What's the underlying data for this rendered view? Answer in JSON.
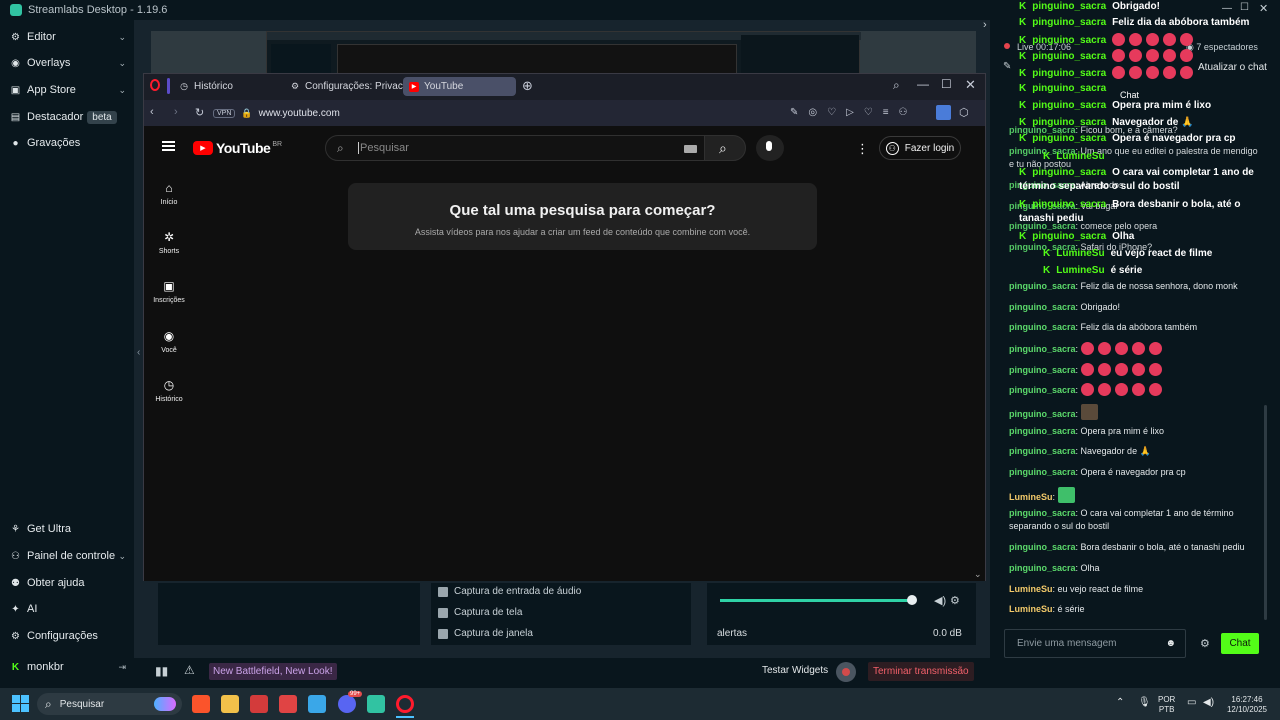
{
  "streamlabs": {
    "title": "Streamlabs Desktop - 1.19.6",
    "sidebar": [
      {
        "label": "Editor",
        "icon": "edit-icon",
        "chevron": true
      },
      {
        "label": "Overlays",
        "icon": "palette-icon",
        "chevron": true
      },
      {
        "label": "App Store",
        "icon": "store-icon",
        "chevron": true
      },
      {
        "label": "Destacador",
        "icon": "highlight-icon",
        "badge": "beta"
      },
      {
        "label": "Gravações",
        "icon": "recording-icon"
      }
    ],
    "sidebar_bottom": [
      {
        "label": "Get Ultra",
        "icon": "ultra-icon"
      },
      {
        "label": "Painel de controle",
        "icon": "dashboard-icon",
        "chevron": true
      },
      {
        "label": "Obter ajuda",
        "icon": "help-icon"
      },
      {
        "label": "AI",
        "icon": "ai-icon"
      },
      {
        "label": "Configurações",
        "icon": "settings-icon"
      },
      {
        "label": "monkbr",
        "icon": "kick-icon"
      }
    ],
    "sources": [
      "Captura de entrada de áudio",
      "Captura de tela",
      "Captura de janela"
    ],
    "mixer": {
      "label": "alertas",
      "level": "0.0 dB",
      "volume_fraction": 0.98
    },
    "footer": {
      "promo": "New Battlefield, New Look!",
      "test_widgets": "Testar Widgets",
      "end_stream": "Terminar transmissão"
    },
    "live": {
      "status": "Live 00:17:06",
      "viewers": "7 espectadores",
      "refresh": "Atualizar o chat",
      "chat_title": "Chat"
    }
  },
  "browser": {
    "tabs": [
      {
        "label": "Histórico",
        "icon": "history-icon"
      },
      {
        "label": "Configurações: Privacidad",
        "icon": "gear-icon"
      },
      {
        "label": "YouTube",
        "icon": "youtube-icon",
        "active": true
      }
    ],
    "url": "www.youtube.com",
    "vpn": "VPN"
  },
  "youtube": {
    "logo": "YouTube",
    "region": "BR",
    "search_placeholder": "Pesquisar",
    "login": "Fazer login",
    "nav": [
      {
        "label": "Início",
        "icon": "home-icon"
      },
      {
        "label": "Shorts",
        "icon": "shorts-icon"
      },
      {
        "label": "Inscrições",
        "icon": "subscriptions-icon"
      },
      {
        "label": "Você",
        "icon": "user-icon"
      },
      {
        "label": "Histórico",
        "icon": "history-icon"
      }
    ],
    "prompt_title": "Que tal uma pesquisa para começar?",
    "prompt_sub": "Assista vídeos para nos ajudar a criar um feed de conteúdo que combine com você."
  },
  "overlay_chat": [
    {
      "user": "pinguino_sacra",
      "text": "Obrigado!"
    },
    {
      "user": "pinguino_sacra",
      "text": "Feliz dia da abóbora também"
    },
    {
      "user": "pinguino_sacra",
      "text": "",
      "emotes": 5
    },
    {
      "user": "pinguino_sacra",
      "text": "",
      "emotes": 5
    },
    {
      "user": "pinguino_sacra",
      "text": "",
      "emotes": 5
    },
    {
      "user": "pinguino_sacra",
      "text": ""
    },
    {
      "user": "pinguino_sacra",
      "text": "Opera pra mim é lixo"
    },
    {
      "user": "pinguino_sacra",
      "text": "Navegador de 🙏"
    },
    {
      "user": "pinguino_sacra",
      "text": "Opera é navegador pra cp"
    },
    {
      "user": "LumineSu",
      "text": ""
    },
    {
      "user": "pinguino_sacra",
      "text": "O cara vai completar 1 ano de término separando o sul do bostil"
    },
    {
      "user": "pinguino_sacra",
      "text": "Bora desbanir o bola, até o tanashi pediu"
    },
    {
      "user": "pinguino_sacra",
      "text": "Olha"
    },
    {
      "user": "LumineSu",
      "text": "eu vejo react de filme"
    },
    {
      "user": "LumineSu",
      "text": "é série"
    }
  ],
  "chat_partial": [
    {
      "user": "pinguino_sacra",
      "text": "Ficou bom, e a câmera?"
    },
    {
      "user": "pinguino_sacra",
      "text": "Um ano que eu editei o palestra de mendigo e tu não postou"
    },
    {
      "user": "pinguino_sacra",
      "text": "Abre todos"
    },
    {
      "user": "pinguino_sacra",
      "text": "Vai bugar"
    },
    {
      "user": "pinguino_sacra",
      "text": "comece pelo opera"
    },
    {
      "user": "pinguino_sacra",
      "text": "Safari do iPhone?"
    }
  ],
  "chat": [
    {
      "user": "pinguino_sacra",
      "text": "Feliz dia de nossa senhora, dono monk"
    },
    {
      "user": "pinguino_sacra",
      "text": "Obrigado!"
    },
    {
      "user": "pinguino_sacra",
      "text": "Feliz dia da abóbora também"
    },
    {
      "user": "pinguino_sacra",
      "text": "",
      "emotes": 5
    },
    {
      "user": "pinguino_sacra",
      "text": "",
      "emotes": 5
    },
    {
      "user": "pinguino_sacra",
      "text": "",
      "emotes": 5
    },
    {
      "user": "pinguino_sacra",
      "text": "",
      "image": true
    },
    {
      "user": "pinguino_sacra",
      "text": "Opera pra mim é lixo"
    },
    {
      "user": "pinguino_sacra",
      "text": "Navegador de 🙏"
    },
    {
      "user": "pinguino_sacra",
      "text": "Opera é navegador pra cp"
    },
    {
      "user": "LumineSu",
      "text": "",
      "image": true
    },
    {
      "user": "pinguino_sacra",
      "text": "O cara vai completar 1 ano de término separando o sul do bostil"
    },
    {
      "user": "pinguino_sacra",
      "text": "Bora desbanir o bola, até o tanashi pediu"
    },
    {
      "user": "pinguino_sacra",
      "text": "Olha"
    },
    {
      "user": "LumineSu",
      "text": "eu vejo react de filme"
    },
    {
      "user": "LumineSu",
      "text": "é série"
    }
  ],
  "chat_input": {
    "placeholder": "Envie uma mensagem",
    "send": "Chat"
  },
  "taskbar": {
    "search": "Pesquisar",
    "lang": "POR",
    "layout": "PTB",
    "time": "16:27:46",
    "date": "12/10/2025",
    "discord_badge": "99+"
  }
}
